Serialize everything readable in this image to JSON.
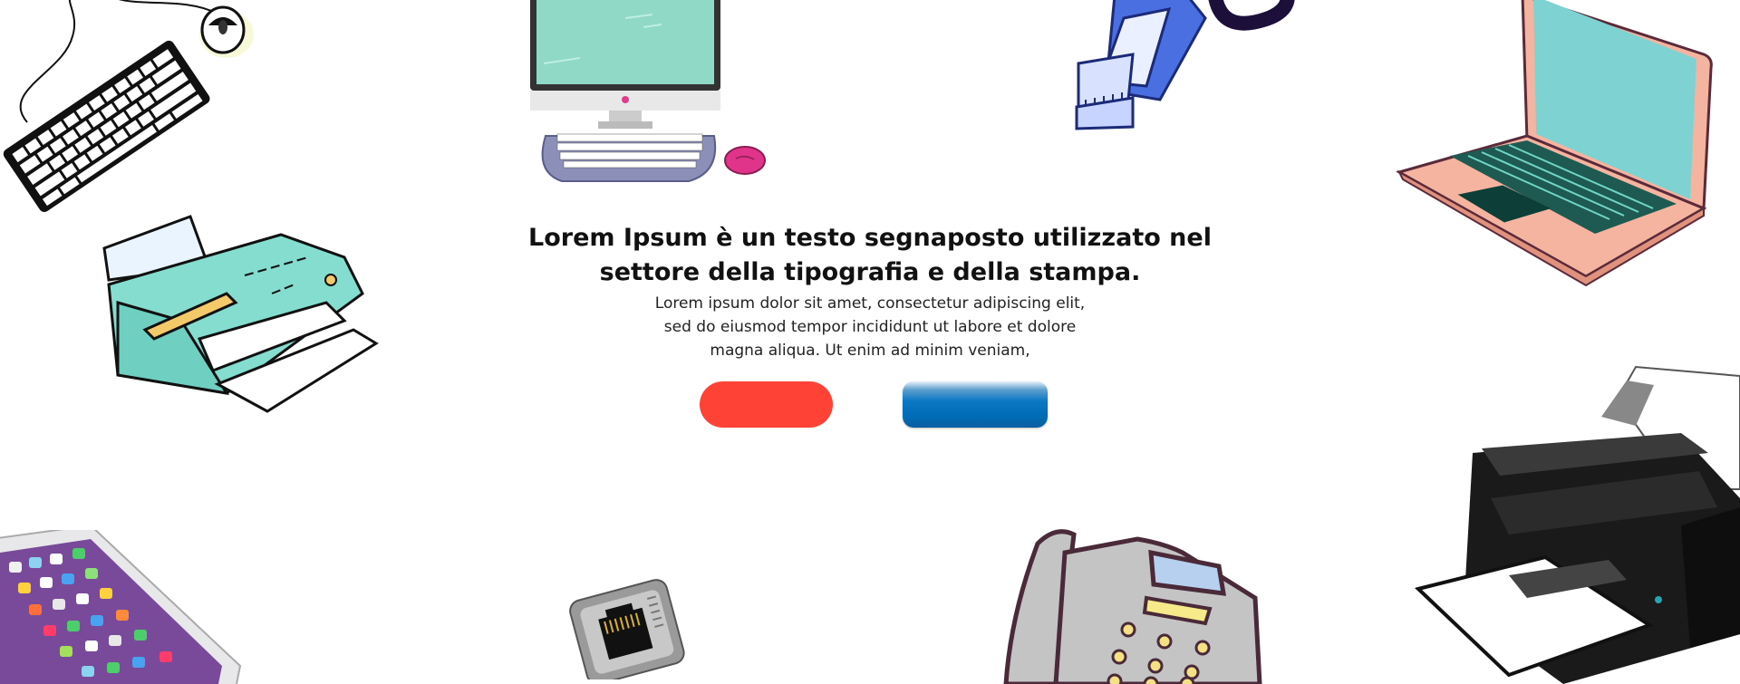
{
  "hero": {
    "heading_line1": "Lorem Ipsum è un testo segnaposto utilizzato nel",
    "heading_line2": "settore della tipografia e della stampa.",
    "body_line1": "Lorem ipsum dolor sit amet, consectetur adipiscing elit,",
    "body_line2": "sed do eiusmod tempor incididunt ut labore et dolore",
    "body_line3": "magna aliqua. Ut enim ad minim veniam,"
  },
  "buttons": {
    "primary_label": "",
    "secondary_label": ""
  },
  "colors": {
    "primary_button": "#fe4336",
    "secondary_button": "#006cb7",
    "printer_body": "#85ddd0",
    "monitor_screen": "#8fd9c6",
    "laptop_body": "#f5b4a0",
    "laptop_screen": "#7fd2d2"
  },
  "illustrations": [
    "keyboard-mouse-icon",
    "desktop-computer-icon",
    "ethernet-cable-icon",
    "laptop-icon",
    "cartoon-printer-icon",
    "smartphone-icon",
    "network-port-icon",
    "fax-phone-icon",
    "black-printer-icon"
  ]
}
